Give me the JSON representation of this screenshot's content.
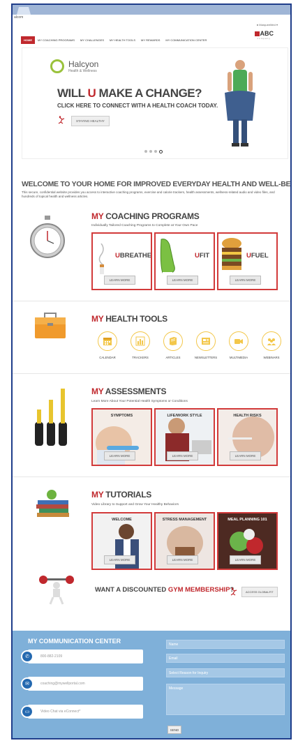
{
  "browser": {
    "url": "alcom"
  },
  "header": {
    "user": "MarqueeMed",
    "brand": "ABC",
    "brand_sub": "company",
    "nav": [
      "HOME",
      "MY COACHING PROGRAMS",
      "MY CHALLENGES",
      "MY HEALTH TOOLS",
      "MY REWARDS",
      "MY COMMUNICATION CENTER"
    ]
  },
  "hero": {
    "logo_name": "Halcyon",
    "logo_sub": "Health & Wellness",
    "title_pre": "WILL ",
    "title_u": "U",
    "title_post": " MAKE A CHANGE?",
    "subtitle": "CLICK HERE TO CONNECT WITH A HEALTH COACH TODAY.",
    "button": "STAYING HEALTHY",
    "slide_count": 4,
    "active_slide": 4
  },
  "welcome": {
    "title": "WELCOME TO YOUR HOME FOR IMPROVED EVERYDAY HEALTH AND WELL-BEING.",
    "text": "This secure, confidential website provides you access to interactive coaching programs, exercise and calorie trackers, health assessments, wellness-related audio and video files, and hundreds of topical health and wellness articles."
  },
  "coaching": {
    "my": "MY",
    "title": " COACHING PROGRAMS",
    "subtitle": "Individually Tailored Coaching Programs to Complete at Your Own Pace",
    "cards": [
      {
        "u": "U",
        "label": "BREATHE",
        "more": "LEARN MORE"
      },
      {
        "u": "U",
        "label": "FIT",
        "more": "LEARN MORE"
      },
      {
        "u": "U",
        "label": "FUEL",
        "more": "LEARN MORE"
      }
    ]
  },
  "tools": {
    "my": "MY",
    "title": " HEALTH TOOLS",
    "items": [
      {
        "label": "CALENDAR",
        "icon": "calendar-icon"
      },
      {
        "label": "TRACKERS",
        "icon": "chart-icon"
      },
      {
        "label": "ARTICLES",
        "icon": "book-icon"
      },
      {
        "label": "NEWSLETTERS",
        "icon": "newsletter-icon"
      },
      {
        "label": "MULTIMEDIA",
        "icon": "video-icon"
      },
      {
        "label": "WEBINARS",
        "icon": "group-icon"
      }
    ]
  },
  "assessments": {
    "my": "MY",
    "title": " ASSESSMENTS",
    "subtitle": "Learn More About Your Potential Health Symptoms or Conditions",
    "cards": [
      {
        "label": "SYMPTOMS",
        "more": "LEARN MORE"
      },
      {
        "label": "LIFE/WORK STYLE",
        "more": "LEARN MORE"
      },
      {
        "label": "HEALTH RISKS",
        "more": "LEARN MORE"
      }
    ]
  },
  "tutorials": {
    "my": "MY",
    "title": " TUTORIALS",
    "subtitle": "Video Library to Support and Grow Your Healthy Behaviors",
    "cards": [
      {
        "label": "WELCOME",
        "more": "LEARN MORE"
      },
      {
        "label": "STRESS MANAGEMENT",
        "more": "LEARN MORE"
      },
      {
        "label": "MEAL PLANNING 101",
        "more": "LEARN MORE"
      }
    ]
  },
  "gym": {
    "pre": "WANT A DISCOUNTED ",
    "red": "GYM MEMBERSHIP",
    "post": "?",
    "button": "ACCESS GLOBALFIT"
  },
  "communication": {
    "title": "MY COMMUNICATION CENTER",
    "phone": "800-882-2109",
    "email": "coaching@mywellportal.com",
    "chat": "Video Chat via eConnect*",
    "form": {
      "name": "Name",
      "email": "Email",
      "reason": "Select Reason for Inquiry",
      "message": "Message",
      "send": "SEND"
    }
  },
  "colors": {
    "accent": "#c0282d",
    "footer": "#7fb0d9",
    "tool_ring": "#f3c74a",
    "icon_blue": "#2469b0"
  }
}
